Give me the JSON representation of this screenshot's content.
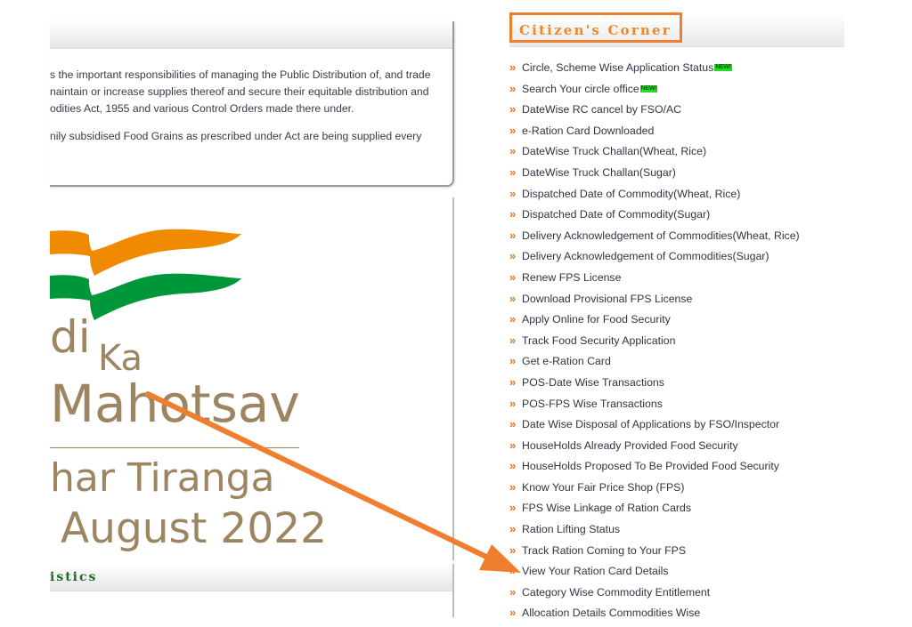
{
  "intro": {
    "lines": [
      "s the important responsibilities of managing the Public Distribution of, and trade",
      "naintain or increase supplies thereof and secure their equitable distribution and",
      "odities Act, 1955 and various Control Orders made there under.",
      "nily subsidised Food Grains as prescribed under Act are being supplied every"
    ]
  },
  "banner": {
    "line1": "di",
    "line1b": "Ka",
    "line2": "Mahotsav",
    "line3": "har Tiranga",
    "line4": "August 2022",
    "colors": {
      "saffron": "#f08a00",
      "green": "#00963a",
      "text": "#9c8560"
    }
  },
  "statistics": {
    "title": "istics"
  },
  "citizens_corner": {
    "title": "Citizen's Corner",
    "bullet": "»",
    "new_label": "NEW!",
    "items": [
      {
        "label": "Circle, Scheme Wise Application Status",
        "is_new": true
      },
      {
        "label": "Search Your circle office",
        "is_new": true
      },
      {
        "label": "DateWise RC cancel by FSO/AC"
      },
      {
        "label": "e-Ration Card Downloaded"
      },
      {
        "label": "DateWise Truck Challan(Wheat, Rice)"
      },
      {
        "label": "DateWise Truck Challan(Sugar)"
      },
      {
        "label": "Dispatched Date of Commodity(Wheat, Rice)"
      },
      {
        "label": "Dispatched Date of Commodity(Sugar)"
      },
      {
        "label": "Delivery Acknowledgement of Commodities(Wheat, Rice)"
      },
      {
        "label": "Delivery Acknowledgement of Commodities(Sugar)"
      },
      {
        "label": "Renew FPS License"
      },
      {
        "label": "Download Provisional FPS License"
      },
      {
        "label": "Apply Online for Food Security"
      },
      {
        "label": "Track Food Security Application"
      },
      {
        "label": "Get e-Ration Card"
      },
      {
        "label": "POS-Date Wise Transactions"
      },
      {
        "label": "POS-FPS Wise Transactions"
      },
      {
        "label": "Date Wise Disposal of Applications by FSO/Inspector"
      },
      {
        "label": "HouseHolds Already Provided Food Security"
      },
      {
        "label": "HouseHolds Proposed To Be Provided Food Security"
      },
      {
        "label": "Know Your Fair Price Shop (FPS)"
      },
      {
        "label": "FPS Wise Linkage of Ration Cards"
      },
      {
        "label": "Ration Lifting Status"
      },
      {
        "label": "Track Ration Coming to Your FPS"
      },
      {
        "label": "View Your Ration Card Details"
      },
      {
        "label": "Category Wise Commodity Entitlement"
      },
      {
        "label": "Allocation Details Commodities Wise"
      }
    ]
  },
  "annotation": {
    "highlight_color": "#ef7f2e",
    "target_item": "View Your Ration Card Details"
  }
}
